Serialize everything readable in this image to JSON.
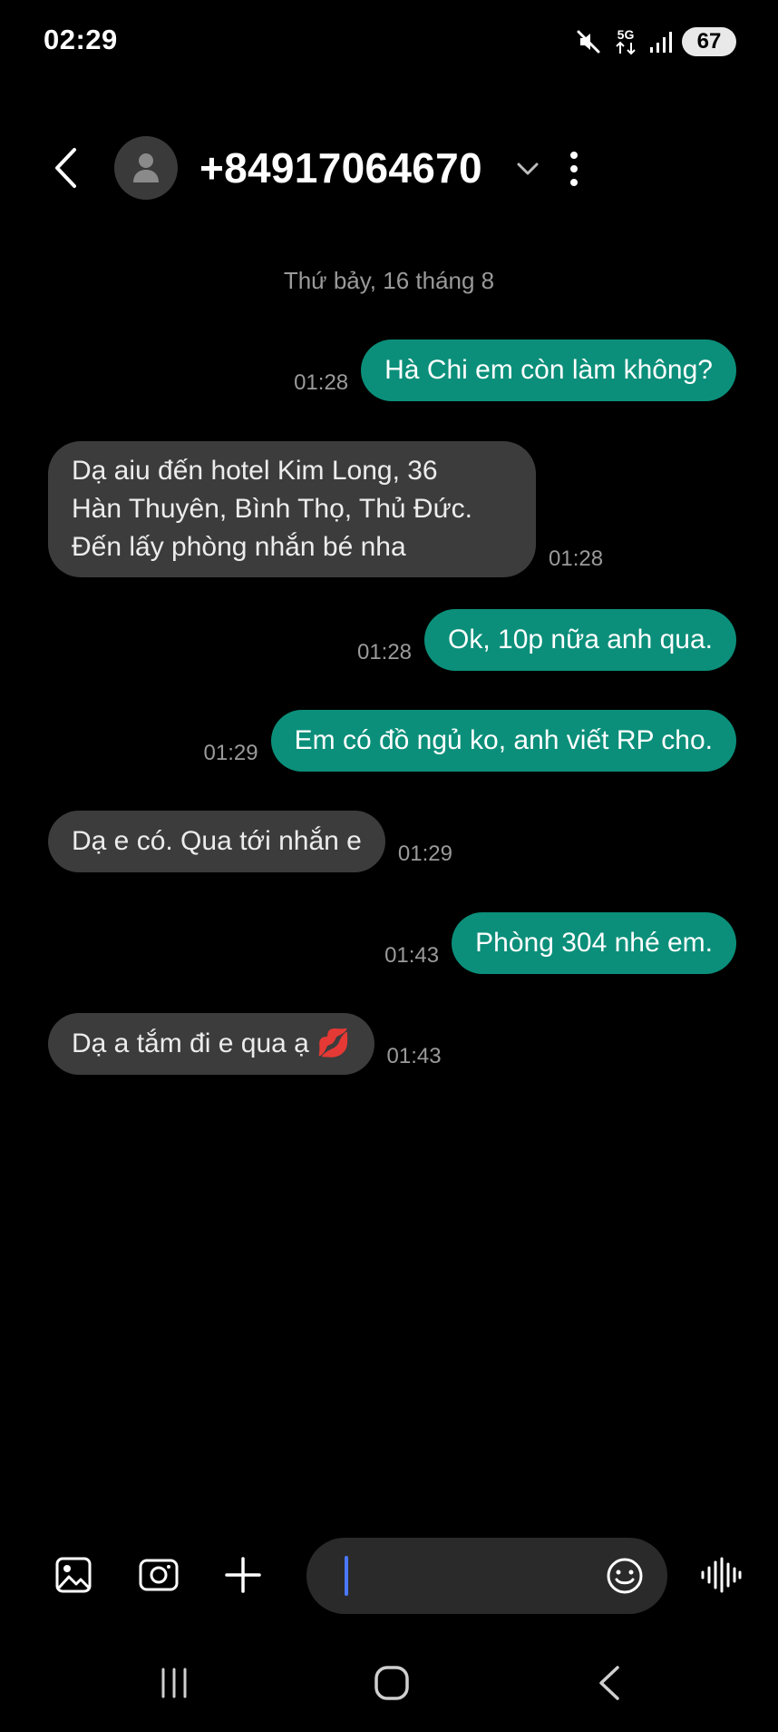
{
  "status_bar": {
    "time": "02:29",
    "network": "5G",
    "battery": "67"
  },
  "header": {
    "contact_number": "+84917064670",
    "icons": [
      "back-arrow-icon",
      "avatar-person-icon",
      "chevron-down-icon",
      "more-vert-icon"
    ]
  },
  "conversation": {
    "date_separator": "Thứ bảy, 16 tháng 8",
    "messages": [
      {
        "direction": "sent",
        "text": "Hà Chi em còn làm không?",
        "time": "01:28"
      },
      {
        "direction": "received",
        "text": "Dạ aiu đến hotel Kim Long, 36\nHàn Thuyên, Bình Thọ, Thủ Đức.\nĐến lấy phòng nhắn bé nha",
        "time": "01:28"
      },
      {
        "direction": "sent",
        "text": "Ok, 10p nữa anh qua.",
        "time": "01:28"
      },
      {
        "direction": "sent",
        "text": "Em có đồ ngủ ko, anh viết RP cho.",
        "time": "01:29"
      },
      {
        "direction": "received",
        "text": "Dạ e có. Qua tới nhắn e",
        "time": "01:29"
      },
      {
        "direction": "sent",
        "text": "Phòng 304 nhé em.",
        "time": "01:43"
      },
      {
        "direction": "received",
        "text": "Dạ a tắm đi e qua ạ 💋",
        "time": "01:43"
      }
    ]
  },
  "composer": {
    "input_value": "",
    "icons": [
      "gallery-icon",
      "camera-icon",
      "plus-icon",
      "emoji-icon",
      "voice-waveform-icon"
    ]
  },
  "colors": {
    "background": "#000000",
    "sent_bubble": "#0b8f7a",
    "received_bubble": "#3c3c3d",
    "timestamp": "#9a9a9a",
    "caret": "#4a78ff"
  }
}
